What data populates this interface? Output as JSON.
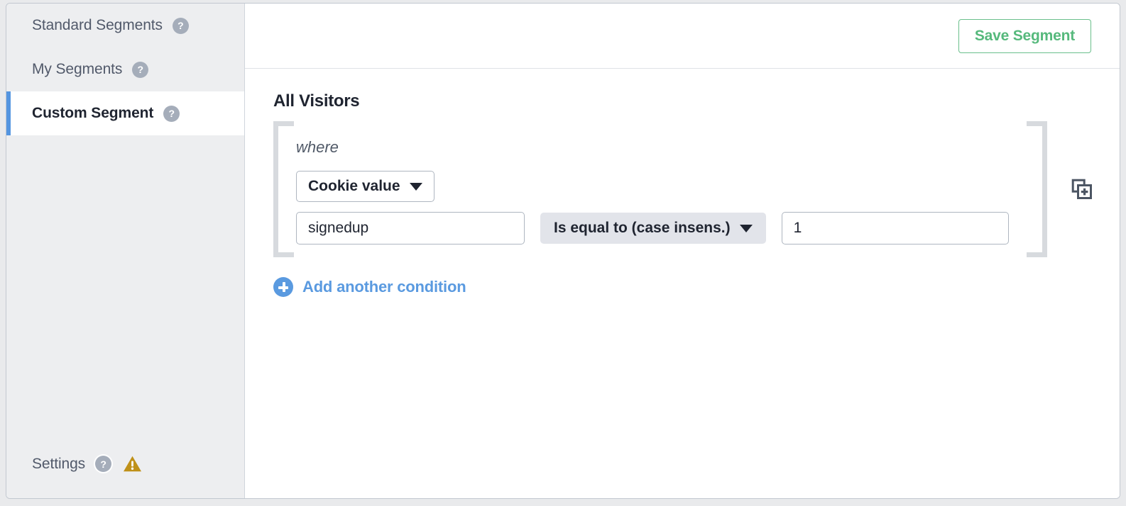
{
  "sidebar": {
    "items": [
      {
        "label": "Standard Segments",
        "help_icon": "help-circle-icon",
        "active": false
      },
      {
        "label": "My Segments",
        "help_icon": "help-circle-icon",
        "active": false
      },
      {
        "label": "Custom Segment",
        "help_icon": "help-circle-icon",
        "active": true
      }
    ],
    "settings": {
      "label": "Settings",
      "help_icon": "help-circle-icon",
      "warning_icon": "warning-triangle-icon"
    },
    "help_glyph": "?"
  },
  "topbar": {
    "save_label": "Save Segment"
  },
  "main": {
    "title": "All Visitors",
    "where_label": "where",
    "duplicate_icon": "duplicate-block-icon",
    "condition": {
      "dimension": "Cookie value",
      "dimension_caret": "chevron-down-icon",
      "name_value": "signedup",
      "name_placeholder": "",
      "operator": "Is equal to (case insens.)",
      "operator_caret": "chevron-down-icon",
      "value": "1",
      "value_placeholder": ""
    },
    "add_condition": {
      "label": "Add another condition",
      "icon": "plus-circle-icon"
    }
  },
  "colors": {
    "accent_blue": "#5a9ae0",
    "save_green": "#56b97c",
    "warning_gold": "#bf9119",
    "sidebar_bg": "#edeef0",
    "bracket_grey": "#d7dade",
    "operator_bg": "#e2e4ea"
  }
}
